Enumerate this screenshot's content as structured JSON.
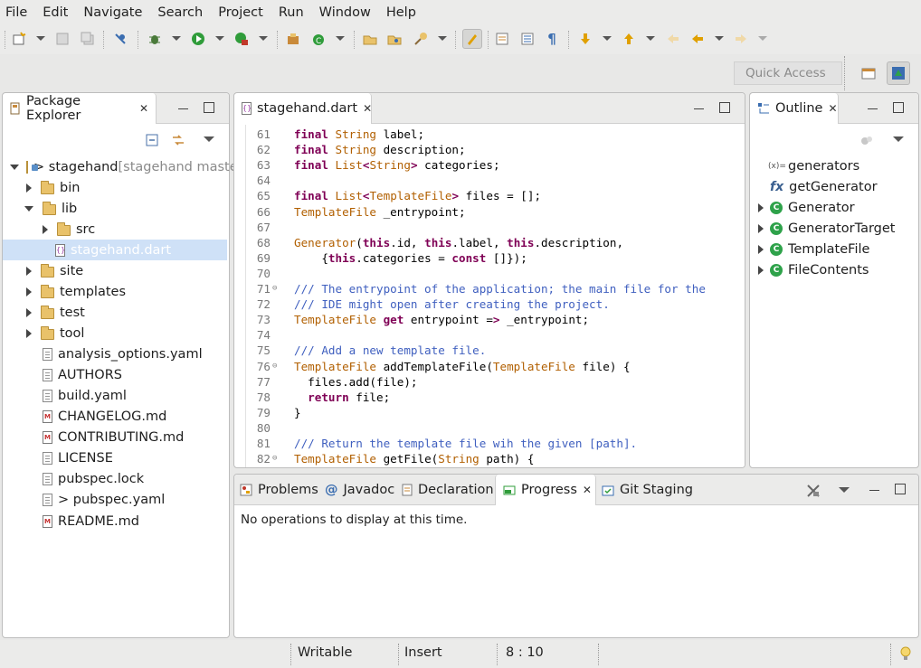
{
  "menubar": {
    "items": [
      "File",
      "Edit",
      "Navigate",
      "Search",
      "Project",
      "Run",
      "Window",
      "Help"
    ]
  },
  "toolbar": {
    "quick_access_placeholder": "Quick Access"
  },
  "package_explorer": {
    "title": "Package Explorer",
    "tree": [
      {
        "label": "> stagehand",
        "suffix": " [stagehand maste",
        "icon": "project-icon"
      },
      {
        "label": "bin",
        "icon": "folder-icon"
      },
      {
        "label": "lib",
        "icon": "folder-icon"
      },
      {
        "label": "src",
        "icon": "folder-icon"
      },
      {
        "label": "stagehand.dart",
        "icon": "dart-file-icon"
      },
      {
        "label": "site",
        "icon": "folder-icon"
      },
      {
        "label": "templates",
        "icon": "folder-icon"
      },
      {
        "label": "test",
        "icon": "folder-icon"
      },
      {
        "label": "tool",
        "icon": "folder-icon"
      },
      {
        "label": "analysis_options.yaml",
        "icon": "file-icon"
      },
      {
        "label": "AUTHORS",
        "icon": "file-icon"
      },
      {
        "label": "build.yaml",
        "icon": "file-icon"
      },
      {
        "label": "CHANGELOG.md",
        "icon": "markdown-icon"
      },
      {
        "label": "CONTRIBUTING.md",
        "icon": "markdown-icon"
      },
      {
        "label": "LICENSE",
        "icon": "file-icon"
      },
      {
        "label": "pubspec.lock",
        "icon": "file-icon"
      },
      {
        "label": "> pubspec.yaml",
        "icon": "file-icon"
      },
      {
        "label": "README.md",
        "icon": "markdown-icon"
      }
    ]
  },
  "editor": {
    "tab": "stagehand.dart",
    "lines": [
      {
        "n": "61",
        "t": "final String label;"
      },
      {
        "n": "62",
        "t": "final String description;"
      },
      {
        "n": "63",
        "t": "final List<String> categories;"
      },
      {
        "n": "64",
        "t": ""
      },
      {
        "n": "65",
        "t": "final List<TemplateFile> files = [];"
      },
      {
        "n": "66",
        "t": "TemplateFile _entrypoint;"
      },
      {
        "n": "67",
        "t": ""
      },
      {
        "n": "68",
        "t": "Generator(this.id, this.label, this.description,"
      },
      {
        "n": "69",
        "t": "    {this.categories = const []});"
      },
      {
        "n": "70",
        "t": ""
      },
      {
        "n": "71",
        "t": "/// The entrypoint of the application; the main file for the"
      },
      {
        "n": "72",
        "t": "/// IDE might open after creating the project."
      },
      {
        "n": "73",
        "t": "TemplateFile get entrypoint => _entrypoint;"
      },
      {
        "n": "74",
        "t": ""
      },
      {
        "n": "75",
        "t": "/// Add a new template file."
      },
      {
        "n": "76",
        "t": "TemplateFile addTemplateFile(TemplateFile file) {"
      },
      {
        "n": "77",
        "t": "  files.add(file);"
      },
      {
        "n": "78",
        "t": "  return file;"
      },
      {
        "n": "79",
        "t": "}"
      },
      {
        "n": "80",
        "t": ""
      },
      {
        "n": "81",
        "t": "/// Return the template file wih the given [path]."
      },
      {
        "n": "82",
        "t": "TemplateFile getFile(String path) {"
      }
    ]
  },
  "outline": {
    "title": "Outline",
    "items": [
      {
        "label": "generators",
        "icon": "variable-icon",
        "expandable": false
      },
      {
        "label": "getGenerator",
        "icon": "function-icon",
        "expandable": false
      },
      {
        "label": "Generator",
        "icon": "class-icon",
        "expandable": true
      },
      {
        "label": "GeneratorTarget",
        "icon": "class-icon",
        "expandable": true
      },
      {
        "label": "TemplateFile",
        "icon": "class-icon",
        "expandable": true
      },
      {
        "label": "FileContents",
        "icon": "class-icon",
        "expandable": true
      }
    ]
  },
  "bottom": {
    "tabs": [
      "Problems",
      "Javadoc",
      "Declaration",
      "Progress",
      "Git Staging"
    ],
    "active_tab": "Progress",
    "message": "No operations to display at this time."
  },
  "statusbar": {
    "mode": "Writable",
    "insert": "Insert",
    "position": "8 : 10"
  },
  "colors": {
    "keyword": "#7f0055",
    "type": "#b15f00",
    "comment": "#3f5fbf",
    "selection": "#cfe1f7"
  }
}
